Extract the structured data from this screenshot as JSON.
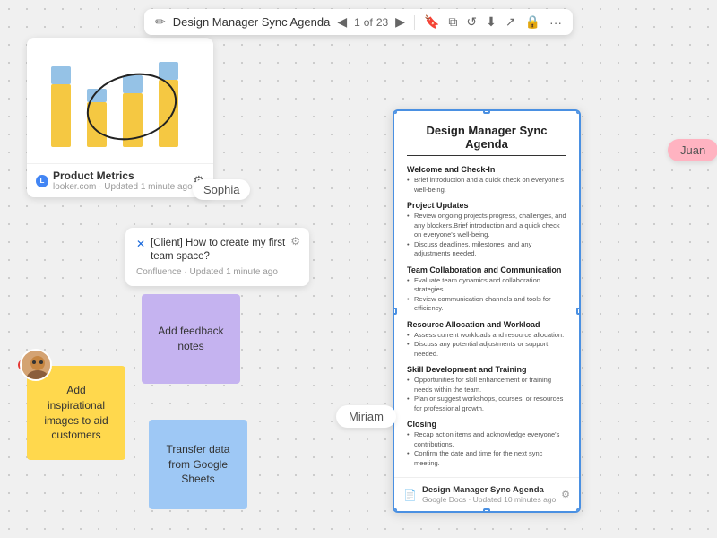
{
  "toolbar": {
    "pencil_icon": "✏️",
    "title": "Design Manager Sync Agenda",
    "nav_current": "1",
    "nav_separator": "of",
    "nav_total": "23",
    "bookmark_icon": "🔖",
    "copy_icon": "⧉",
    "refresh_icon": "↺",
    "download_icon": "↓",
    "export_icon": "↗",
    "lock_icon": "🔒",
    "more_icon": "···"
  },
  "chart_card": {
    "title": "Product Metrics",
    "subtitle": "looker.com · Updated 1 minute ago",
    "settings_icon": "⚙"
  },
  "confluence_card": {
    "title": "[Client] How to create my first team space?",
    "meta": "Confluence · Updated 1 minute ago",
    "settings_icon": "⚙"
  },
  "sticky_purple": {
    "text": "Add feedback notes"
  },
  "sticky_blue_bottom": {
    "text": "Transfer data from Google Sheets"
  },
  "sticky_yellow": {
    "text": "Add inspirational images to aid customers"
  },
  "sophia_label": "Sophia",
  "miriam_label": "Miriam",
  "juan_label": "Juan",
  "document": {
    "main_title": "Design Manager Sync Agenda",
    "sections": [
      {
        "title": "Welcome and Check-In",
        "bullets": [
          "Brief introduction and a quick check on everyone's well-being."
        ]
      },
      {
        "title": "Project Updates",
        "bullets": [
          "Review ongoing projects progress, challenges, and any blockers.Brief introduction and a quick check on everyone's well-being.",
          "Discuss deadlines, milestones, and any adjustments needed."
        ]
      },
      {
        "title": "Team Collaboration and Communication",
        "bullets": [
          "Evaluate team dynamics and collaboration strategies.",
          "Review communication channels and tools for efficiency."
        ]
      },
      {
        "title": "Resource Allocation and Workload",
        "bullets": [
          "Assess current workloads and resource allocation.",
          "Discuss any potential adjustments or support needed."
        ]
      },
      {
        "title": "Skill Development and Training",
        "bullets": [
          "Opportunities for skill enhancement or training needs within the team.",
          "Plan or suggest workshops, courses, or resources for professional growth."
        ]
      },
      {
        "title": "Closing",
        "bullets": [
          "Recap action items and acknowledge everyone's contributions.",
          "Confirm the date and time for the next sync meeting."
        ]
      }
    ],
    "footer_title": "Design Manager Sync Agenda",
    "footer_meta": "Google Docs · Updated 10 minutes ago"
  }
}
